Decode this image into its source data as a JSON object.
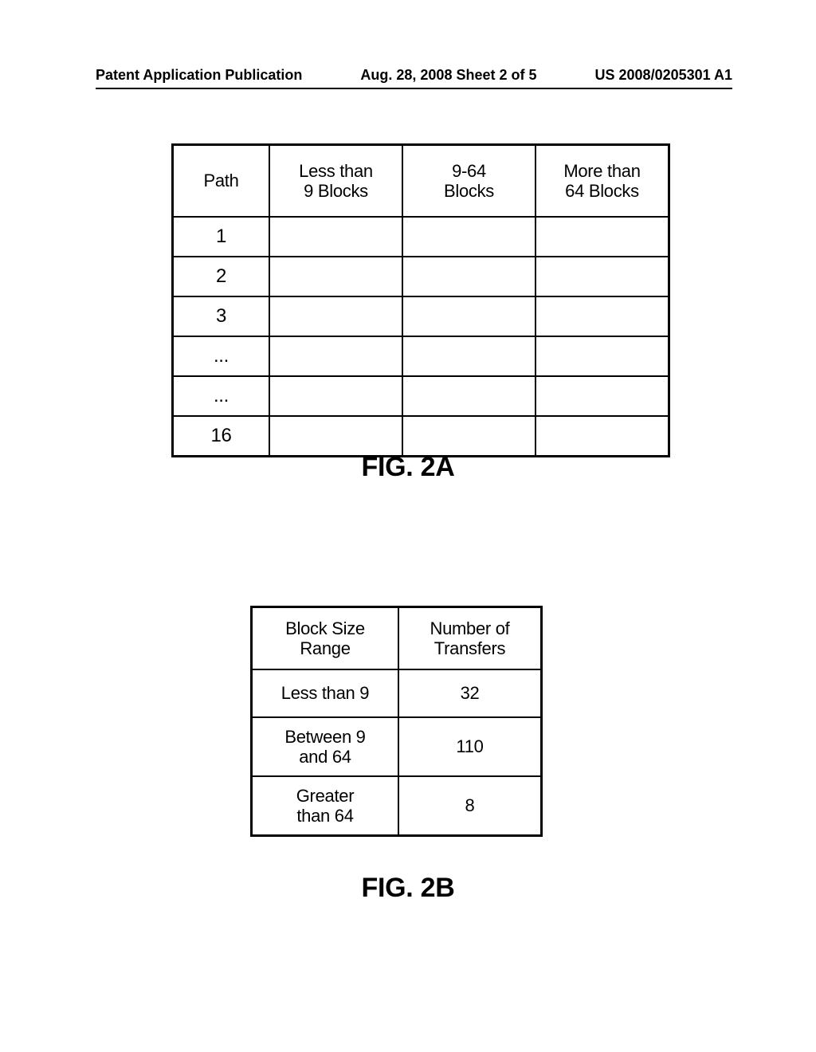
{
  "header": {
    "left": "Patent Application Publication",
    "center": "Aug. 28, 2008  Sheet 2 of 5",
    "right": "US 2008/0205301 A1"
  },
  "tableA": {
    "headers": [
      "Path",
      "Less than\n9 Blocks",
      "9-64\nBlocks",
      "More than\n64 Blocks"
    ],
    "rows": [
      [
        "1",
        "",
        "",
        ""
      ],
      [
        "2",
        "",
        "",
        ""
      ],
      [
        "3",
        "",
        "",
        ""
      ],
      [
        "...",
        "",
        "",
        ""
      ],
      [
        "...",
        "",
        "",
        ""
      ],
      [
        "16",
        "",
        "",
        ""
      ]
    ],
    "caption": "FIG. 2A"
  },
  "tableB": {
    "headers": [
      "Block Size\nRange",
      "Number of\nTransfers"
    ],
    "rows": [
      [
        "Less than 9",
        "32"
      ],
      [
        "Between 9\nand 64",
        "110"
      ],
      [
        "Greater\nthan 64",
        "8"
      ]
    ],
    "caption": "FIG. 2B"
  }
}
